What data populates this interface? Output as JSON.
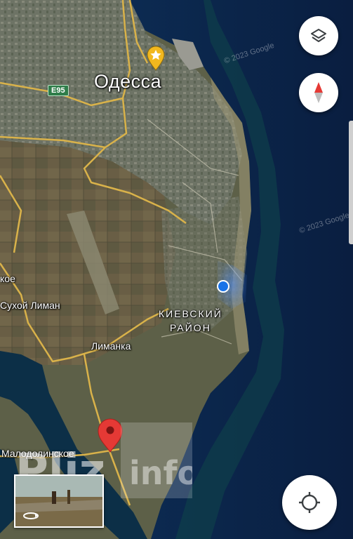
{
  "map": {
    "city_label": "Одесса",
    "district_line1": "КИЕВСКИЙ",
    "district_line2": "РАЙОН",
    "road_shield": "E95",
    "places": {
      "koe": "кое",
      "sukhoi_liman": "Сухой Лиман",
      "limanka": "Лиманка",
      "malodolinskoe": "Малодолинское"
    },
    "copyright_1": "© 2023 Google",
    "copyright_2": "© 2023 Google"
  },
  "controls": {
    "layers_icon": "layers-icon",
    "compass_icon": "compass-icon",
    "my_location_icon": "crosshair-icon",
    "rotate_icon": "rotate-360-icon"
  },
  "watermark": {
    "text_left": "Pliz",
    "text_right": "info"
  },
  "colors": {
    "sea": "#0d2a4f",
    "shallow_sea": "#0e4a4a",
    "pin_red": "#e53935",
    "location_blue": "#1a73e8",
    "road_yellow": "#d9b24a"
  }
}
